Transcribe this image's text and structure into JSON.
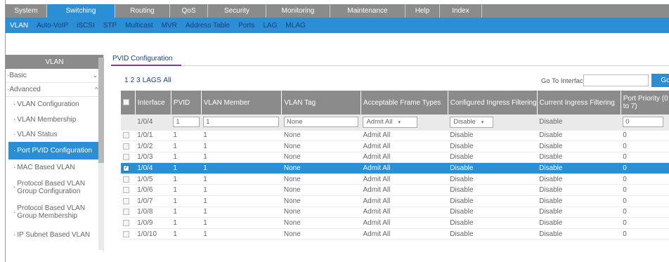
{
  "topnav": {
    "tabs": [
      {
        "label": "System",
        "width": 59
      },
      {
        "label": "Switching",
        "width": 97
      },
      {
        "label": "Routing",
        "width": 78
      },
      {
        "label": "QoS",
        "width": 54
      },
      {
        "label": "Security",
        "width": 83
      },
      {
        "label": "Monitoring",
        "width": 91
      },
      {
        "label": "Maintenance",
        "width": 107
      },
      {
        "label": "Help",
        "width": 49
      },
      {
        "label": "Index",
        "width": 60
      }
    ],
    "active": 1
  },
  "subnav": {
    "items": [
      "VLAN",
      "Auto-VoIP",
      "iSCSI",
      "STP",
      "Multicast",
      "MVR",
      "Address Table",
      "Ports",
      "LAG",
      "MLAG"
    ],
    "active": 0
  },
  "sidebar": {
    "title": "VLAN",
    "basic": "Basic",
    "advanced": "Advanced",
    "basic_chevron": "⌄",
    "advanced_chevron": "^",
    "items": [
      "VLAN Configuration",
      "VLAN Membership",
      "VLAN Status",
      "Port PVID Configuration",
      "MAC Based VLAN",
      "Protocol Based VLAN Group Configuration",
      "Protocol Based VLAN Group Membership",
      "IP Subnet Based VLAN"
    ],
    "active_index": 3
  },
  "main": {
    "page_title": "PVID Configuration",
    "filters": [
      "1",
      "2",
      "3",
      "LAGS",
      "All"
    ],
    "goto_label": "Go To Interface",
    "goto_value": "",
    "go_button": "Go",
    "columns": [
      "Interface",
      "PVID",
      "VLAN Member",
      "VLAN Tag",
      "Acceptable Frame Types",
      "Configured Ingress Filtering",
      "Current Ingress Filtering",
      "Port Priority (0 to 7)"
    ],
    "edit_row": {
      "interface": "1/0/4",
      "pvid": "1",
      "vlan_member": "1",
      "vlan_tag": "None",
      "frame_types": "Admit All",
      "configured_filtering": "Disable",
      "current_filtering": "Disable",
      "priority": "0"
    },
    "rows": [
      {
        "checked": false,
        "interface": "1/0/1",
        "pvid": "1",
        "member": "1",
        "tag": "None",
        "frame": "Admit All",
        "cfg": "Disable",
        "cur": "Disable",
        "pri": "0"
      },
      {
        "checked": false,
        "interface": "1/0/2",
        "pvid": "1",
        "member": "1",
        "tag": "None",
        "frame": "Admit All",
        "cfg": "Disable",
        "cur": "Disable",
        "pri": "0"
      },
      {
        "checked": false,
        "interface": "1/0/3",
        "pvid": "1",
        "member": "1",
        "tag": "None",
        "frame": "Admit All",
        "cfg": "Disable",
        "cur": "Disable",
        "pri": "0"
      },
      {
        "checked": true,
        "interface": "1/0/4",
        "pvid": "1",
        "member": "1",
        "tag": "None",
        "frame": "Admit All",
        "cfg": "Disable",
        "cur": "Disable",
        "pri": "0"
      },
      {
        "checked": false,
        "interface": "1/0/5",
        "pvid": "1",
        "member": "1",
        "tag": "None",
        "frame": "Admit All",
        "cfg": "Disable",
        "cur": "Disable",
        "pri": "0"
      },
      {
        "checked": false,
        "interface": "1/0/6",
        "pvid": "1",
        "member": "1",
        "tag": "None",
        "frame": "Admit All",
        "cfg": "Disable",
        "cur": "Disable",
        "pri": "0"
      },
      {
        "checked": false,
        "interface": "1/0/7",
        "pvid": "1",
        "member": "1",
        "tag": "None",
        "frame": "Admit All",
        "cfg": "Disable",
        "cur": "Disable",
        "pri": "0"
      },
      {
        "checked": false,
        "interface": "1/0/8",
        "pvid": "1",
        "member": "1",
        "tag": "None",
        "frame": "Admit All",
        "cfg": "Disable",
        "cur": "Disable",
        "pri": "0"
      },
      {
        "checked": false,
        "interface": "1/0/9",
        "pvid": "1",
        "member": "1",
        "tag": "None",
        "frame": "Admit All",
        "cfg": "Disable",
        "cur": "Disable",
        "pri": "0"
      },
      {
        "checked": false,
        "interface": "1/0/10",
        "pvid": "1",
        "member": "1",
        "tag": "None",
        "frame": "Admit All",
        "cfg": "Disable",
        "cur": "Disable",
        "pri": "0"
      }
    ],
    "dropdown_arrow": "▾"
  },
  "colors": {
    "accent": "#2a8fd4",
    "header_gray": "#8b8b8b",
    "link_navy": "#1b3f78",
    "tab_underline": "#7c3f8f"
  }
}
